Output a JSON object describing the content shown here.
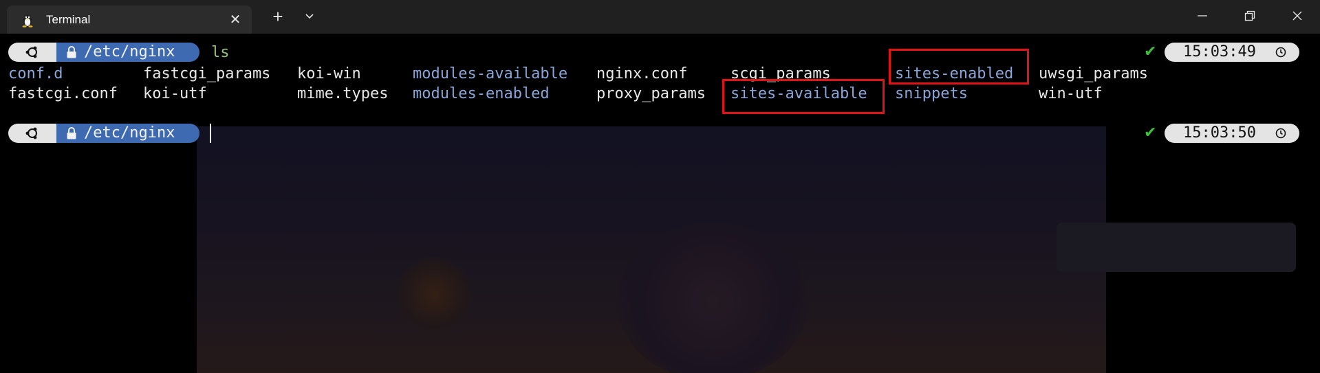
{
  "window": {
    "tab_title": "Terminal",
    "tab_icon": "linux-tux-icon",
    "controls": [
      "minimize-icon",
      "maximize-icon",
      "close-icon"
    ]
  },
  "terminal": {
    "prompt1": {
      "path": "/etc/nginx",
      "command": "ls",
      "time": "15:03:49"
    },
    "ls_output": {
      "row1": [
        {
          "name": "conf.d",
          "type": "dir"
        },
        {
          "name": "fastcgi_params",
          "type": "file"
        },
        {
          "name": "koi-win",
          "type": "file"
        },
        {
          "name": "modules-available",
          "type": "dir"
        },
        {
          "name": "nginx.conf",
          "type": "file"
        },
        {
          "name": "scgi_params",
          "type": "file"
        },
        {
          "name": "sites-enabled",
          "type": "dir"
        },
        {
          "name": "uwsgi_params",
          "type": "file"
        }
      ],
      "row2": [
        {
          "name": "fastcgi.conf",
          "type": "file"
        },
        {
          "name": "koi-utf",
          "type": "file"
        },
        {
          "name": "mime.types",
          "type": "file"
        },
        {
          "name": "modules-enabled",
          "type": "dir"
        },
        {
          "name": "proxy_params",
          "type": "file"
        },
        {
          "name": "sites-available",
          "type": "dir"
        },
        {
          "name": "snippets",
          "type": "dir"
        },
        {
          "name": "win-utf",
          "type": "file"
        }
      ]
    },
    "prompt2": {
      "path": "/etc/nginx",
      "time": "15:03:50"
    },
    "colors": {
      "directory": "#8aa6d9",
      "file": "#e8e8e8",
      "command": "#98c379",
      "path_segment": "#3d6ab0",
      "highlight": "#e01414",
      "success_check": "#3fbf3f"
    },
    "status_check": "✔"
  }
}
